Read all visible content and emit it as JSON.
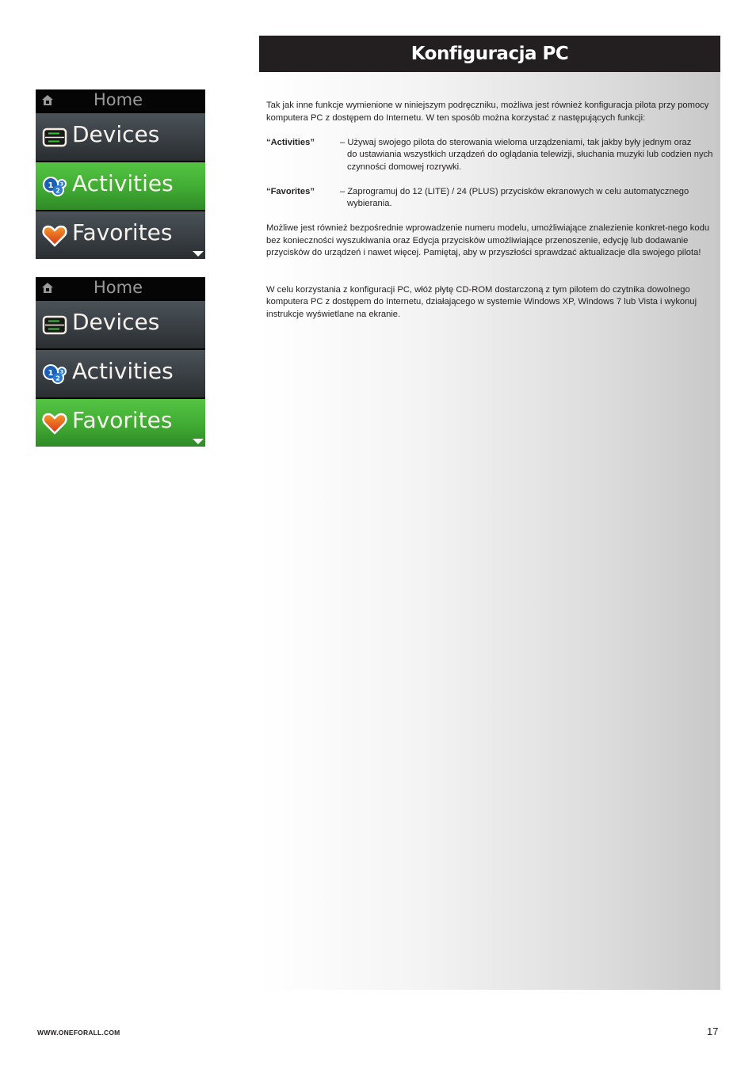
{
  "header": {
    "title": "Konfiguracja PC"
  },
  "remote_screens": [
    {
      "title": "Home",
      "title_icon": "home-icon",
      "items": [
        {
          "label": "Devices",
          "icon": "devices-icon",
          "selected": false
        },
        {
          "label": "Activities",
          "icon": "activities-icon",
          "selected": true
        },
        {
          "label": "Favorites",
          "icon": "favorites-heart-icon",
          "selected": false
        }
      ],
      "scroll_indicator": "down-arrow-icon"
    },
    {
      "title": "Home",
      "title_icon": "home-icon",
      "items": [
        {
          "label": "Devices",
          "icon": "devices-icon",
          "selected": false
        },
        {
          "label": "Activities",
          "icon": "activities-icon",
          "selected": false
        },
        {
          "label": "Favorites",
          "icon": "favorites-heart-icon",
          "selected": true
        }
      ],
      "scroll_indicator": "down-arrow-icon"
    }
  ],
  "content": {
    "intro": "Tak jak inne funkcje wymienione w niniejszym podręczniku, możliwa jest również konfiguracja pilota przy pomocy komputera PC z dostępem do Internetu. W ten sposób można korzystać z następujących funkcji:",
    "definitions": [
      {
        "term": "“Activities”",
        "line1": "– Używaj swojego pilota do sterowania wieloma urządzeniami, tak jakby były jednym oraz",
        "rest": "do ustawiania wszystkich urządzeń do oglądania telewizji, słuchania muzyki lub codzien nych czynności domowej rozrywki."
      },
      {
        "term": "“Favorites”",
        "line1": "– Zaprogramuj do 12 (LITE) / 24 (PLUS) przycisków ekranowych w celu automatycznego",
        "rest": "wybierania."
      }
    ],
    "paragraph2": "Możliwe jest również bezpośrednie wprowadzenie numeru modelu, umożliwiające znalezienie konkret-nego kodu bez konieczności wyszukiwania oraz Edycja przycisków umożliwiające przenoszenie, edycję lub dodawanie przycisków do urządzeń i nawet więcej. Pamiętaj, aby w przyszłości sprawdzać aktualizacje dla swojego pilota!",
    "paragraph3": "W celu korzystania z konfiguracji PC, włóż płytę CD-ROM dostarczoną z tym pilotem do czytnika dowolnego komputera PC z dostępem do Internetu, działającego w systemie Windows XP,  Windows 7 lub Vista i wykonuj instrukcje wyświetlane na ekranie."
  },
  "footer": {
    "url": "WWW.ONEFORALL.COM",
    "page_number": "17"
  },
  "colors": {
    "header_bg": "#231f20",
    "selected_row": "#40ab33",
    "unselected_row": "#3a4045"
  }
}
